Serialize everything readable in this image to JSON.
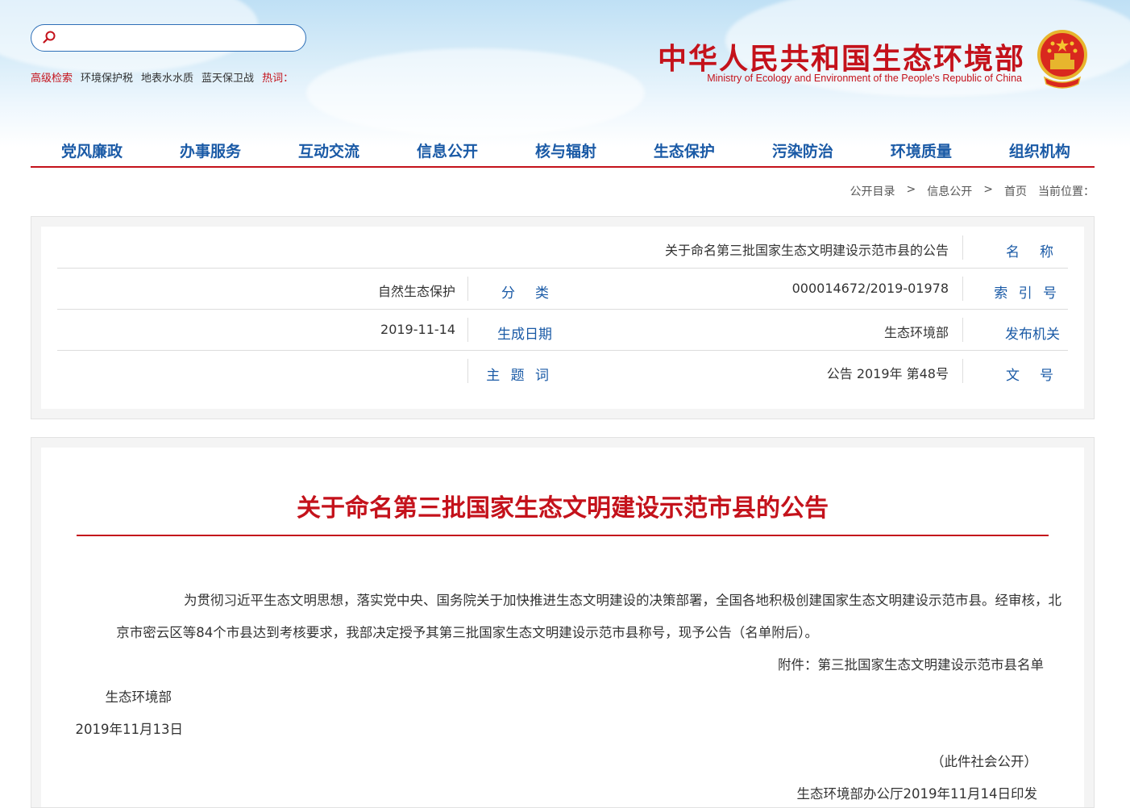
{
  "header": {
    "title_cn": "中华人民共和国生态环境部",
    "title_en": "Ministry of Ecology and Environment of the People's Republic of China",
    "search_placeholder": "",
    "hot_label": "热词：",
    "hot_words": [
      "蓝天保卫战",
      "地表水水质",
      "环境保护税"
    ],
    "advanced_search": "高级检索"
  },
  "nav": {
    "items": [
      "组织机构",
      "环境质量",
      "污染防治",
      "生态保护",
      "核与辐射",
      "信息公开",
      "互动交流",
      "办事服务",
      "党风廉政"
    ]
  },
  "breadcrumb": {
    "label": "当前位置：",
    "items": [
      "首页",
      "信息公开",
      "公开目录"
    ],
    "sep": ">"
  },
  "meta": {
    "name_label": "名　称",
    "name_value": "关于命名第三批国家生态文明建设示范市县的公告",
    "index_label": "索 引 号",
    "index_value": "000014672/2019-01978",
    "category_label": "分　类",
    "category_value": "自然生态保护",
    "issuer_label": "发布机关",
    "issuer_value": "生态环境部",
    "date_label": "生成日期",
    "date_value": "2019-11-14",
    "doc_no_label": "文　号",
    "doc_no_value": "公告 2019年 第48号",
    "keywords_label": "主 题 词",
    "keywords_value": ""
  },
  "doc": {
    "title": "关于命名第三批国家生态文明建设示范市县的公告",
    "para1_line1": "为贯彻习近平生态文明思想，落实党中央、国务院关于加快推进生态文明建设的决策部署，全国各地积极创建国家生态文明建设示范市县。经审核，北",
    "para1_line2": "京市密云区等84个市县达到考核要求，我部决定授予其第三批国家生态文明建设示范市县称号，现予公告（名单附后）。",
    "attachment": "附件：第三批国家生态文明建设示范市县名单",
    "signer": "生态环境部",
    "sign_date": "2019年11月13日",
    "public_note": "（此件社会公开）",
    "issue_note": "生态环境部办公厅2019年11月14日印发"
  },
  "colors": {
    "brand_red": "#c4121b",
    "link_blue": "#1a5aa6"
  }
}
